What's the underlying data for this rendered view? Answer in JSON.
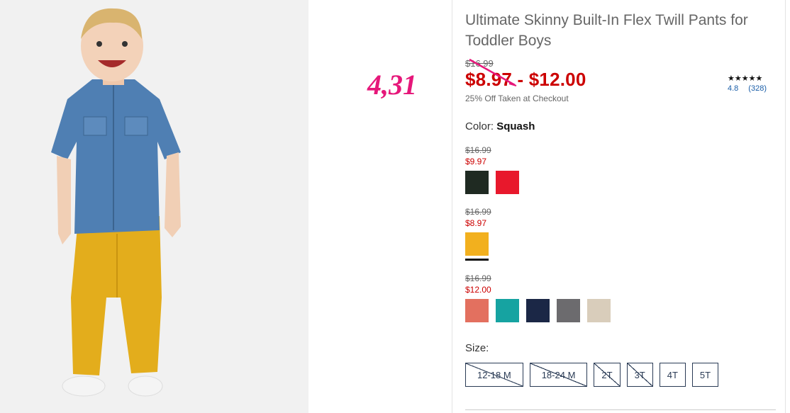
{
  "annotation": "4,31",
  "product": {
    "title": "Ultimate Skinny Built-In Flex Twill Pants for Toddler Boys",
    "original_price": "$16.99",
    "sale_price_range": "$8.97 - $12.00",
    "promo_text": "25% Off Taken at Checkout"
  },
  "rating": {
    "stars": "★★★★★",
    "score": "4.8",
    "count": "(328)"
  },
  "color": {
    "label": "Color:",
    "selected": "Squash"
  },
  "color_groups": [
    {
      "original_price": "$16.99",
      "sale_price": "$9.97",
      "swatches": [
        {
          "name": "dark green",
          "hex": "#1f2a22"
        },
        {
          "name": "red",
          "hex": "#e8182c"
        }
      ]
    },
    {
      "original_price": "$16.99",
      "sale_price": "$8.97",
      "swatches": [
        {
          "name": "squash",
          "hex": "#f2b01e",
          "selected": true
        }
      ]
    },
    {
      "original_price": "$16.99",
      "sale_price": "$12.00",
      "swatches": [
        {
          "name": "coral",
          "hex": "#e3705f"
        },
        {
          "name": "teal",
          "hex": "#16a3a1"
        },
        {
          "name": "navy",
          "hex": "#1b2746"
        },
        {
          "name": "gray",
          "hex": "#6c6b6e"
        },
        {
          "name": "khaki",
          "hex": "#d9cdbb"
        }
      ]
    }
  ],
  "size": {
    "label": "Size:",
    "options": [
      {
        "label": "12-18 M",
        "available": false
      },
      {
        "label": "18-24 M",
        "available": false
      },
      {
        "label": "2T",
        "available": false
      },
      {
        "label": "3T",
        "available": false
      },
      {
        "label": "4T",
        "available": true
      },
      {
        "label": "5T",
        "available": true
      }
    ]
  },
  "colors": {
    "sale_red": "#cc0000",
    "annotation_pink": "#e6177a",
    "link_blue": "#1a5ea8",
    "size_border": "#2a3b55"
  }
}
